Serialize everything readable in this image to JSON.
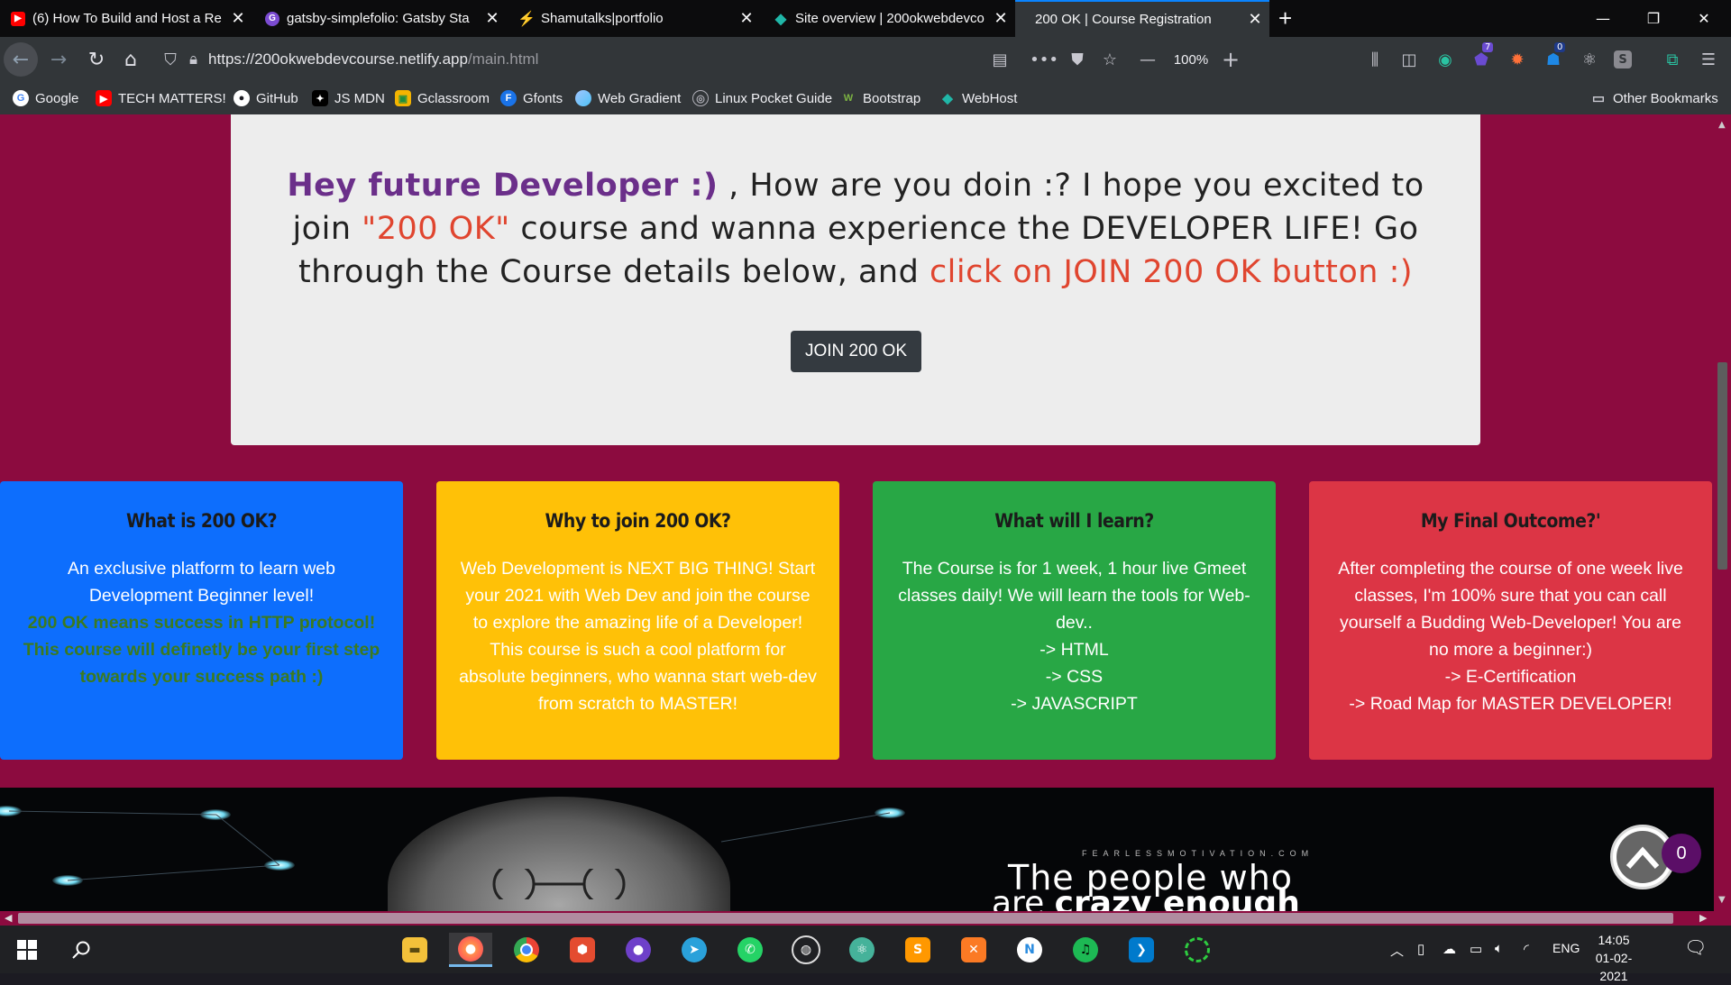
{
  "tabs": [
    {
      "title": "(6) How To Build and Host a Re",
      "favicon_color": "#ff0000",
      "favicon": "▶"
    },
    {
      "title": "gatsby-simplefolio: Gatsby Sta",
      "favicon_color": "#7b4bd1",
      "favicon": "G"
    },
    {
      "title": "Shamutalks|portfolio",
      "favicon_color": "#f5c518",
      "favicon": "⚡"
    },
    {
      "title": "Site overview | 200okwebdevco",
      "favicon_color": "#20b7a8",
      "favicon": "◆"
    },
    {
      "title": "200 OK | Course Registration",
      "favicon_color": "",
      "favicon": ""
    }
  ],
  "new_tab": "+",
  "window_controls": {
    "minimize": "—",
    "restore": "❐",
    "close": "✕"
  },
  "nav": {
    "url_host": "https://200okwebdevcourse.netlify.app",
    "url_path": "/main.html",
    "zoom": "100%",
    "zoom_out": "—",
    "zoom_in": "+",
    "badges": {
      "extension_a": "7",
      "extension_b": "0"
    }
  },
  "bookmarks": [
    {
      "label": "Google",
      "icon": "G",
      "color": "#ffffff",
      "text_color": "#4285f4"
    },
    {
      "label": "TECH MATTERS!",
      "icon": "▶",
      "color": "#ff0000",
      "text_color": "#ffffff"
    },
    {
      "label": "GitHub",
      "icon": "●",
      "color": "#ffffff",
      "text_color": "#1c1b22"
    },
    {
      "label": "JS MDN",
      "icon": "✦",
      "color": "#000000",
      "text_color": "#ffffff"
    },
    {
      "label": "Gclassroom",
      "icon": "▣",
      "color": "#f4b400",
      "text_color": "#1e8e3e"
    },
    {
      "label": "Gfonts",
      "icon": "F",
      "color": "#1a73e8",
      "text_color": "#ffffff"
    },
    {
      "label": "Web Gradient",
      "icon": "●",
      "color": "#4fc3f7",
      "text_color": "#e1f5fe"
    },
    {
      "label": "Linux Pocket Guide",
      "icon": "◎",
      "color": "#3a3a3d",
      "text_color": "#9bc4ff"
    },
    {
      "label": "Bootstrap",
      "icon": "W",
      "color": "#323639",
      "text_color": "#7cb342"
    },
    {
      "label": "WebHost",
      "icon": "◆",
      "color": "#323639",
      "text_color": "#20b7a8"
    }
  ],
  "other_bookmarks": "Other Bookmarks",
  "hero": {
    "greeting": "Hey future Developer :)",
    "line_part1": " , How are you doin :? I hope you excited to join ",
    "course_name": "\"200 OK\"",
    "line_part2": " course and wanna experience the DEVELOPER LIFE! Go through the Course details below, and ",
    "cta_text": "click on JOIN 200 OK button :)",
    "button": "JOIN 200 OK"
  },
  "cards": [
    {
      "title": "What is 200 OK?",
      "body": "An exclusive platform to learn web Development Beginner level!",
      "highlight": "200 OK means success in HTTP protocol! This course will definetly be your first step towards your success path :)"
    },
    {
      "title": "Why to join 200 OK?",
      "body": "Web Development is NEXT BIG THING! Start your 2021 with Web Dev and join the course to explore the amazing life of a Developer! This course is such a cool platform for absolute beginners, who wanna start web-dev from scratch to MASTER!"
    },
    {
      "title": "What will I learn?",
      "body": "The Course is for 1 week, 1 hour live Gmeet classes daily! We will learn the tools for Web-dev..",
      "list": [
        "-> HTML",
        "-> CSS",
        "-> JAVASCRIPT"
      ]
    },
    {
      "title": "My Final Outcome?'",
      "body": "After completing the course of one week live classes, I'm 100% sure that you can call yourself a Budding Web-Developer! You are no more a beginner:)",
      "list": [
        "-> E-Certification",
        "-> Road Map for MASTER DEVELOPER!"
      ]
    }
  ],
  "banner": {
    "source": "FEARLESSMOTIVATION.COM",
    "quote_line1": "The people who",
    "quote_line2_plain": "are",
    "quote_line2_bold": "crazy enough"
  },
  "notification_count": "0",
  "taskbar": {
    "apps": [
      {
        "name": "file-explorer",
        "glyph": "▬",
        "color": "#f3c13a"
      },
      {
        "name": "firefox",
        "glyph": "◉",
        "color": "#ff7139",
        "active": true
      },
      {
        "name": "chrome",
        "glyph": "◉",
        "color": "#34a853"
      },
      {
        "name": "git",
        "glyph": "⬢",
        "color": "#e44c30"
      },
      {
        "name": "github-desktop",
        "glyph": "●",
        "color": "#6e40c9"
      },
      {
        "name": "telegram",
        "glyph": "➤",
        "color": "#2aa1da"
      },
      {
        "name": "whatsapp",
        "glyph": "✆",
        "color": "#25d366"
      },
      {
        "name": "obs",
        "glyph": "◍",
        "color": "#3b3b3b"
      },
      {
        "name": "atom",
        "glyph": "⚛",
        "color": "#45b29a"
      },
      {
        "name": "sublime",
        "glyph": "S",
        "color": "#ff9800"
      },
      {
        "name": "xampp",
        "glyph": "✕",
        "color": "#fb7a24"
      },
      {
        "name": "notion",
        "glyph": "N",
        "color": "#2a8ce0"
      },
      {
        "name": "spotify",
        "glyph": "♫",
        "color": "#1db954"
      },
      {
        "name": "vscode",
        "glyph": "❯",
        "color": "#007acc"
      },
      {
        "name": "loader",
        "glyph": "◌",
        "color": "#2ecc40"
      }
    ],
    "language": "ENG",
    "time": "14:05",
    "date": "01-02-2021"
  }
}
